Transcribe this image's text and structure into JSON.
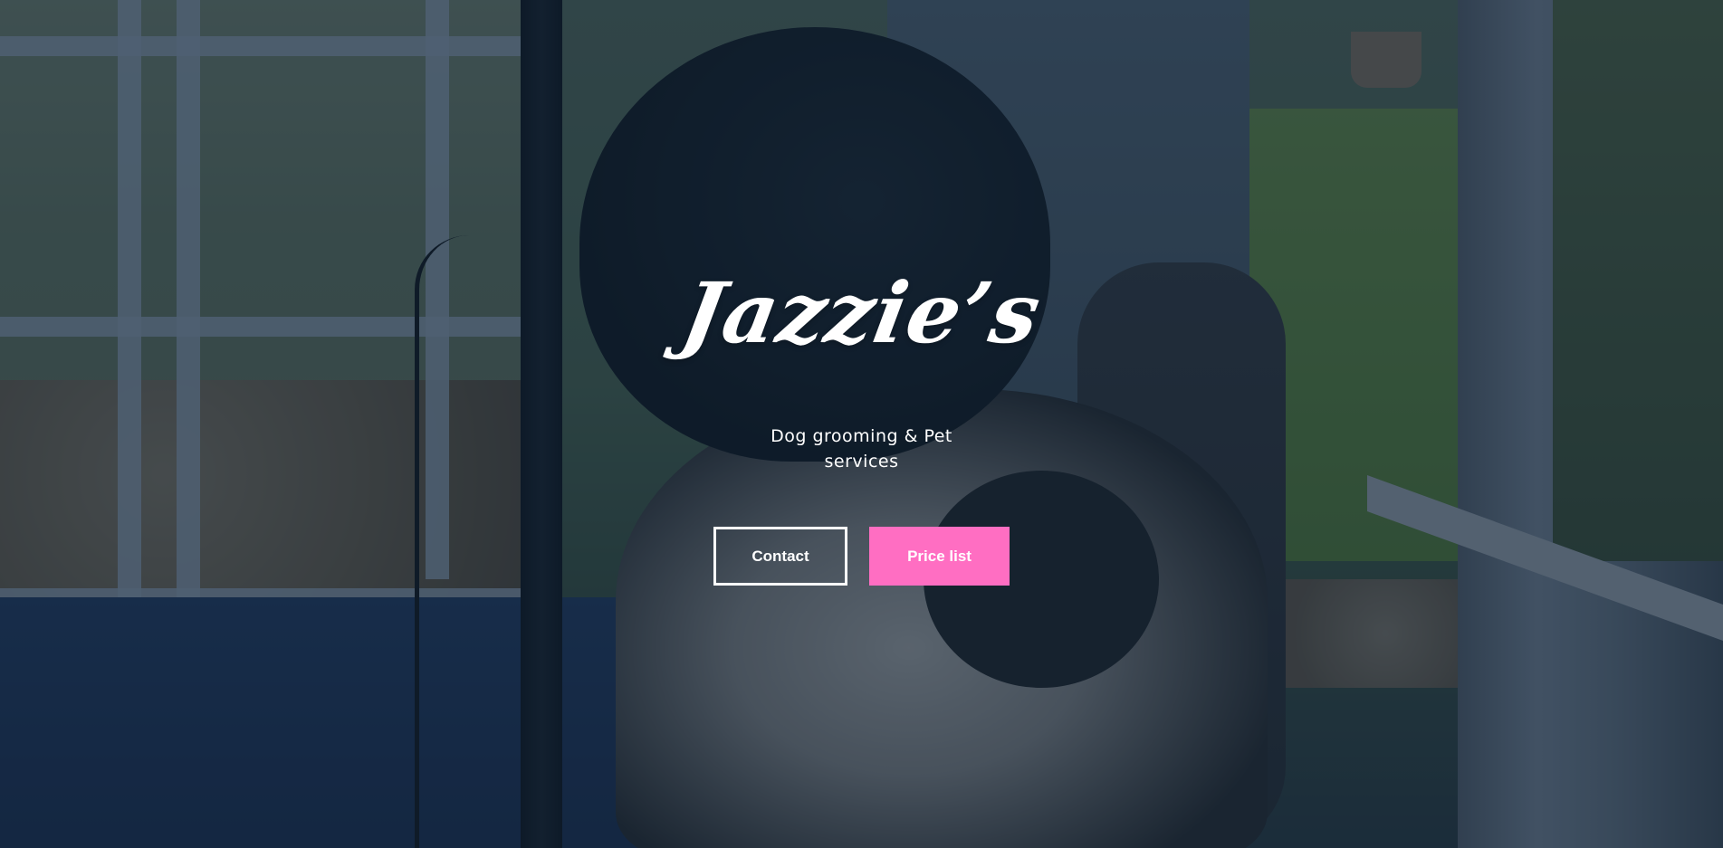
{
  "hero": {
    "brand": "Jazzie’s",
    "tagline": "Dog grooming & Pet services"
  },
  "actions": {
    "contact_label": "Contact",
    "price_list_label": "Price list"
  },
  "colors": {
    "accent_pink": "#ff6ec2",
    "overlay": "rgba(12, 30, 48, 0.55)",
    "text": "#ffffff"
  }
}
